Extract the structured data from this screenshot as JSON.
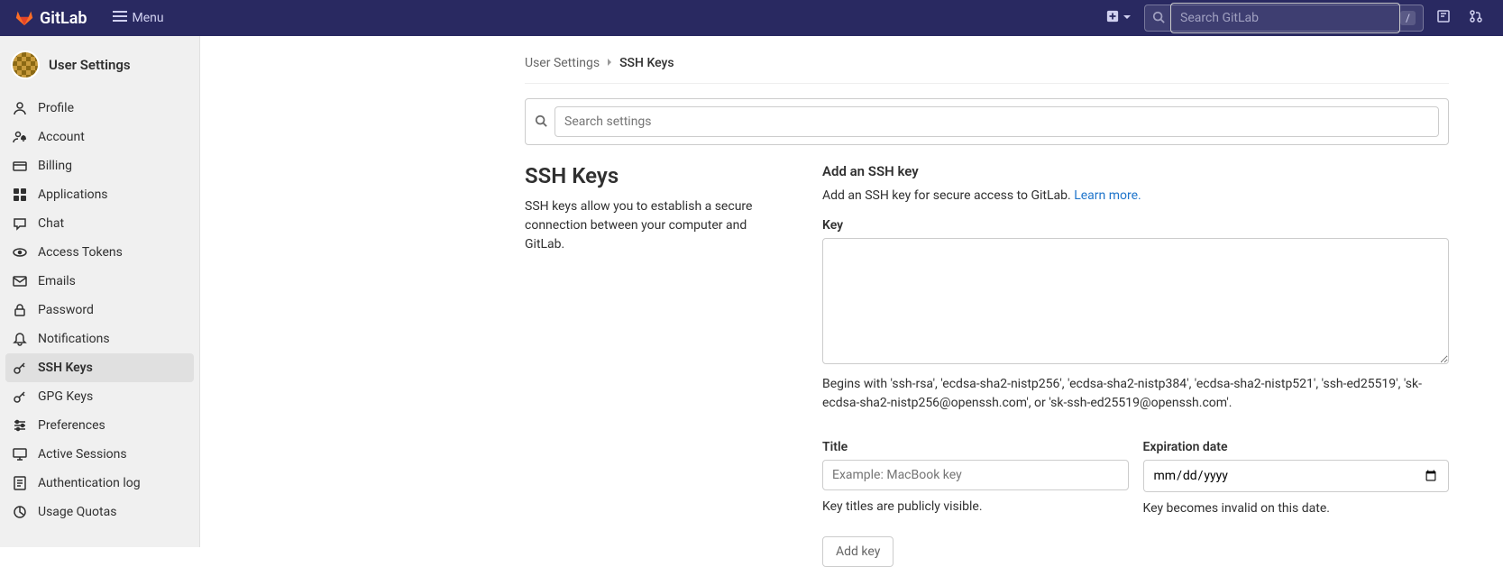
{
  "topbar": {
    "brand": "GitLab",
    "menu_label": "Menu",
    "search_placeholder": "Search GitLab",
    "search_kbd": "/"
  },
  "sidebar": {
    "title": "User Settings",
    "items": [
      {
        "label": "Profile",
        "icon": "profile"
      },
      {
        "label": "Account",
        "icon": "account"
      },
      {
        "label": "Billing",
        "icon": "billing"
      },
      {
        "label": "Applications",
        "icon": "applications"
      },
      {
        "label": "Chat",
        "icon": "chat"
      },
      {
        "label": "Access Tokens",
        "icon": "token"
      },
      {
        "label": "Emails",
        "icon": "email"
      },
      {
        "label": "Password",
        "icon": "lock"
      },
      {
        "label": "Notifications",
        "icon": "bell"
      },
      {
        "label": "SSH Keys",
        "icon": "key",
        "active": true
      },
      {
        "label": "GPG Keys",
        "icon": "key"
      },
      {
        "label": "Preferences",
        "icon": "preferences"
      },
      {
        "label": "Active Sessions",
        "icon": "monitor"
      },
      {
        "label": "Authentication log",
        "icon": "log"
      },
      {
        "label": "Usage Quotas",
        "icon": "quota"
      }
    ]
  },
  "breadcrumb": {
    "parent": "User Settings",
    "current": "SSH Keys"
  },
  "search_settings_placeholder": "Search settings",
  "page": {
    "heading": "SSH Keys",
    "description": "SSH keys allow you to establish a secure connection between your computer and GitLab.",
    "add_heading": "Add an SSH key",
    "add_intro": "Add an SSH key for secure access to GitLab. ",
    "learn_more": "Learn more.",
    "key_label": "Key",
    "key_help": "Begins with 'ssh-rsa', 'ecdsa-sha2-nistp256', 'ecdsa-sha2-nistp384', 'ecdsa-sha2-nistp521', 'ssh-ed25519', 'sk-ecdsa-sha2-nistp256@openssh.com', or 'sk-ssh-ed25519@openssh.com'.",
    "title_label": "Title",
    "title_placeholder": "Example: MacBook key",
    "title_help": "Key titles are publicly visible.",
    "expiration_label": "Expiration date",
    "expiration_placeholder": "mm/dd/yyyy",
    "expiration_help": "Key becomes invalid on this date.",
    "submit_label": "Add key"
  }
}
